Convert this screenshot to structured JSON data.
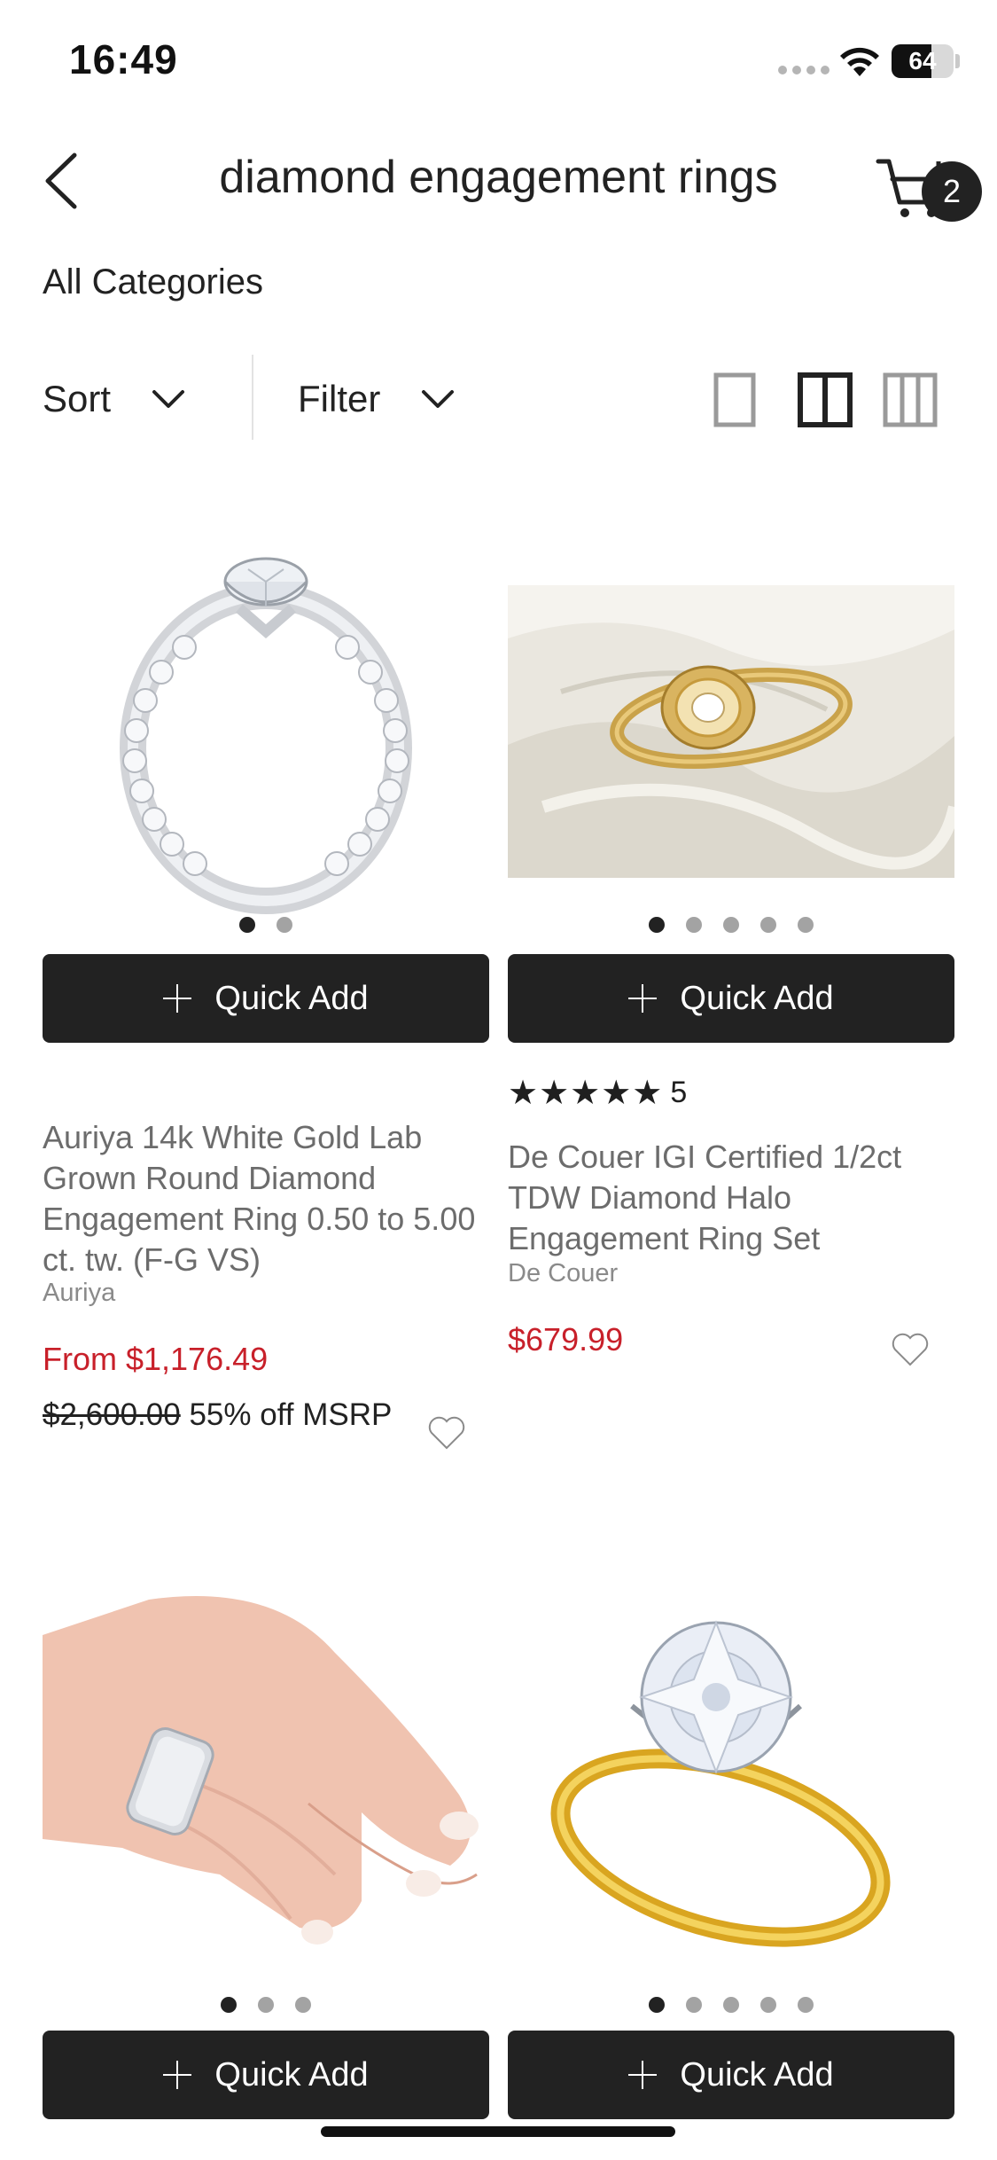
{
  "status_bar": {
    "time": "16:49",
    "battery": "64",
    "battery_level": 0.64
  },
  "header": {
    "title": "diamond engagement rings",
    "cart_count": "2"
  },
  "category": "All Categories",
  "toolbar": {
    "sort_label": "Sort",
    "filter_label": "Filter",
    "selected_view": "two-column"
  },
  "products": [
    {
      "quick_add_label": "Quick Add",
      "name": "Auriya 14k White Gold Lab Grown Round Diamond Engagement Ring 0.50 to 5.00 ct. tw. (F-G VS)",
      "brand": "Auriya",
      "price": "From $1,176.49",
      "msrp_price": "$2,600.00",
      "msrp_discount": "55% off MSRP",
      "image_count": 2,
      "active_image": 1
    },
    {
      "quick_add_label": "Quick Add",
      "rating_stars": 5,
      "rating_count": "5",
      "name": "De Couer IGI Certified 1/2ct TDW Diamond Halo Engagement Ring Set",
      "brand": "De Couer",
      "price": "$679.99",
      "image_count": 5,
      "active_image": 1
    },
    {
      "quick_add_label": "Quick Add",
      "image_count": 3,
      "active_image": 1
    },
    {
      "quick_add_label": "Quick Add",
      "image_count": 5,
      "active_image": 1
    }
  ],
  "colors": {
    "accent_dark": "#222222",
    "sale_price": "#c8202a",
    "muted_text": "#6c6c6c"
  },
  "icons": [
    "back-arrow-icon",
    "cart-icon",
    "chevron-down-icon",
    "single-column-view-icon",
    "two-column-view-icon",
    "three-column-view-icon",
    "plus-icon",
    "heart-icon",
    "star-icon",
    "wifi-icon"
  ]
}
